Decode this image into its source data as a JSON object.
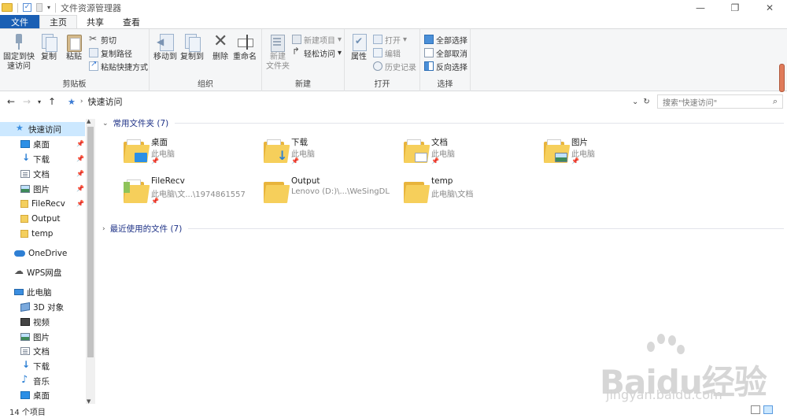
{
  "window": {
    "title": "文件资源管理器",
    "controls": {
      "minimize": "—",
      "maximize": "❐",
      "close": "✕"
    }
  },
  "ribbon_tabs": [
    "文件",
    "主页",
    "共享",
    "查看"
  ],
  "ribbon": {
    "clipboard": {
      "label": "剪贴板",
      "pin": "固定到快\n速访问",
      "copy": "复制",
      "paste": "粘贴",
      "cut": "剪切",
      "copy_path": "复制路径",
      "paste_shortcut": "粘贴快捷方式"
    },
    "organize": {
      "label": "组织",
      "move_to": "移动到",
      "copy_to": "复制到",
      "delete": "删除",
      "rename": "重命名"
    },
    "new": {
      "label": "新建",
      "new_folder": "新建\n文件夹",
      "new_item": "新建项目",
      "easy_access": "轻松访问"
    },
    "open": {
      "label": "打开",
      "properties": "属性",
      "open": "打开",
      "edit": "编辑",
      "history": "历史记录"
    },
    "select": {
      "label": "选择",
      "select_all": "全部选择",
      "select_none": "全部取消",
      "invert": "反向选择"
    }
  },
  "address": {
    "path": "快速访问",
    "search_placeholder": "搜索\"快速访问\""
  },
  "nav_pane": {
    "quick_access": "快速访问",
    "quick_items": [
      {
        "label": "桌面",
        "icon": "desktop-icon",
        "pinned": true
      },
      {
        "label": "下载",
        "icon": "download-icon",
        "pinned": true
      },
      {
        "label": "文档",
        "icon": "document-icon",
        "pinned": true
      },
      {
        "label": "图片",
        "icon": "picture-icon",
        "pinned": true
      },
      {
        "label": "FileRecv",
        "icon": "folder-icon",
        "pinned": true
      },
      {
        "label": "Output",
        "icon": "folder-icon",
        "pinned": false
      },
      {
        "label": "temp",
        "icon": "folder-icon",
        "pinned": false
      }
    ],
    "onedrive": "OneDrive",
    "wps": "WPS网盘",
    "this_pc": "此电脑",
    "pc_items": [
      {
        "label": "3D 对象",
        "icon": "3d-objects-icon"
      },
      {
        "label": "视频",
        "icon": "video-icon"
      },
      {
        "label": "图片",
        "icon": "picture-icon"
      },
      {
        "label": "文档",
        "icon": "document-icon"
      },
      {
        "label": "下载",
        "icon": "download-icon"
      },
      {
        "label": "音乐",
        "icon": "music-icon"
      },
      {
        "label": "桌面",
        "icon": "desktop-icon"
      }
    ]
  },
  "content": {
    "frequent_header": "常用文件夹 (7)",
    "recent_header": "最近使用的文件 (7)",
    "folders": [
      {
        "name": "桌面",
        "location": "此电脑",
        "pinned": true,
        "badge": "desktop"
      },
      {
        "name": "下载",
        "location": "此电脑",
        "pinned": true,
        "badge": "down"
      },
      {
        "name": "文档",
        "location": "此电脑",
        "pinned": true,
        "badge": "doc"
      },
      {
        "name": "图片",
        "location": "此电脑",
        "pinned": true,
        "badge": "pic"
      },
      {
        "name": "FileRecv",
        "location": "此电脑\\文...\\1974861557",
        "pinned": true,
        "badge": "green"
      },
      {
        "name": "Output",
        "location": "Lenovo (D:)\\...\\WeSingDL",
        "pinned": false,
        "badge": "none"
      },
      {
        "name": "temp",
        "location": "此电脑\\文档",
        "pinned": false,
        "badge": "none"
      }
    ]
  },
  "status": {
    "count": "14 个项目"
  },
  "watermark": {
    "brand": "Baidu经验",
    "url": "jingyan.baidu.com"
  },
  "colors": {
    "file_tab": "#1a5fb4",
    "selection": "#cce8ff",
    "folder": "#f6cf5b",
    "section_title": "#1e3287"
  }
}
